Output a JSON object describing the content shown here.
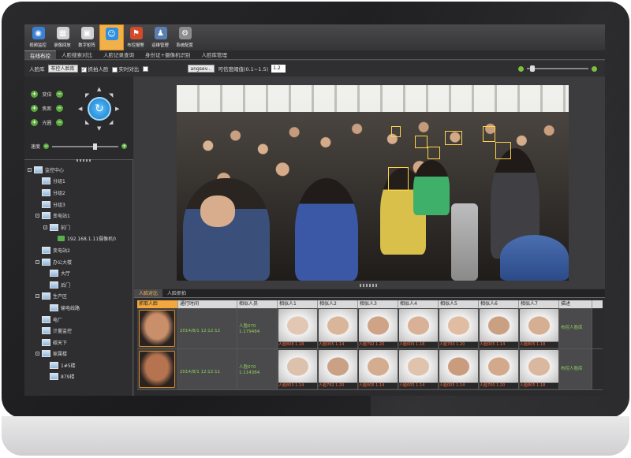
{
  "toolbar": {
    "items": [
      {
        "label": "视频监控",
        "icon": "camera-icon",
        "color": "#3b7fd6"
      },
      {
        "label": "录像回放",
        "icon": "film-icon",
        "color": "#d0d0d0"
      },
      {
        "label": "数字矩阵",
        "icon": "grid-icon",
        "color": "#d0d0d0"
      },
      {
        "label": "",
        "icon": "face-monitor-icon",
        "color": "#2e8fe0",
        "active": true
      },
      {
        "label": "布控报警",
        "icon": "alarm-icon",
        "color": "#d24a2a"
      },
      {
        "label": "运维管理",
        "icon": "admin-icon",
        "color": "#5a7fb0"
      },
      {
        "label": "系统配置",
        "icon": "settings-icon",
        "color": "#8c8c8c"
      }
    ]
  },
  "navtabs": [
    "在线布控",
    "人脸搜索对比",
    "人脸记录查询",
    "身份证+摄像机识别",
    "人脸库管理"
  ],
  "filter": {
    "face_lib_label": "人脸库",
    "face_lib_value": "布控人脸库",
    "capture_face_label": "抓拍人脸",
    "realtime_compare_label": "实时对比",
    "algo_value": "angsev...",
    "threshold_label": "可信度阈值(0.1~1.5)",
    "threshold_value": "1.2"
  },
  "ptz": {
    "rows": [
      "变倍",
      "焦距",
      "光圈"
    ],
    "speed_label": "速度"
  },
  "tree": [
    {
      "label": "监控中心",
      "level": 0,
      "expander": "-"
    },
    {
      "label": "分组1",
      "level": 1
    },
    {
      "label": "分组2",
      "level": 1
    },
    {
      "label": "分组3",
      "level": 1
    },
    {
      "label": "变电站1",
      "level": 1,
      "expander": "-"
    },
    {
      "label": "前门",
      "level": 2,
      "expander": "-"
    },
    {
      "label": "192.168.1.11摄像机0",
      "level": 3,
      "camera": true
    },
    {
      "label": "变电站2",
      "level": 1
    },
    {
      "label": "办公大楼",
      "level": 1,
      "expander": "-"
    },
    {
      "label": "大厅",
      "level": 2
    },
    {
      "label": "后门",
      "level": 2
    },
    {
      "label": "生产区",
      "level": 1,
      "expander": "-"
    },
    {
      "label": "输电线路",
      "level": 2
    },
    {
      "label": "电厂",
      "level": 1
    },
    {
      "label": "计量监控",
      "level": 1
    },
    {
      "label": "碳天下",
      "level": 1
    },
    {
      "label": "家属楼",
      "level": 1,
      "expander": "-"
    },
    {
      "label": "1#5楼",
      "level": 2
    },
    {
      "label": "879楼",
      "level": 2
    }
  ],
  "results": {
    "tabs": [
      "人脸对比",
      "人脸抓拍"
    ],
    "headers": [
      "抓取人脸",
      "通行时间",
      "相似人员",
      "相似人1",
      "相似人2",
      "相似人3",
      "相似人4",
      "相似人5",
      "相似人6",
      "相似人7",
      "描述"
    ],
    "rows": [
      {
        "time": "2014/8/1 12:12:12",
        "sim_name": "人脸070",
        "sim_score": "1.179484",
        "candidates": [
          "人脸808 1.18",
          "人脸005 1.14",
          "人脸792 1.20",
          "人脸005 1.18",
          "人脸700 1.20",
          "人脸005 1.14",
          "人脸805 1.18"
        ],
        "desc": "布控人脸库",
        "face_color": "#c98e6a",
        "cand_colors": [
          "#e2c7b4",
          "#d9b59a",
          "#cfa385",
          "#d8b196",
          "#e0bca2",
          "#caa083",
          "#d6ae92"
        ]
      },
      {
        "time": "2014/8/1 12:12:11",
        "sim_name": "人脸070",
        "sim_score": "1.114384",
        "candidates": [
          "人脸803 1.14",
          "人脸792 1.20",
          "人脸005 1.14",
          "人脸005 1.14",
          "人脸005 1.14",
          "人脸700 1.20",
          "人脸805 1.18"
        ],
        "desc": "布控人脸库",
        "face_color": "#b5744f",
        "cand_colors": [
          "#dcc1ad",
          "#caa184",
          "#d4ad90",
          "#e0c3ac",
          "#c99c7e",
          "#d2a98b",
          "#d9b89f"
        ]
      }
    ]
  },
  "colors": {
    "accent": "#f0b14a",
    "capture_border": "#d88a2a",
    "face_box": "#ffd24a",
    "match_text": "#8fd15a",
    "score_text": "#ff6b3d"
  }
}
